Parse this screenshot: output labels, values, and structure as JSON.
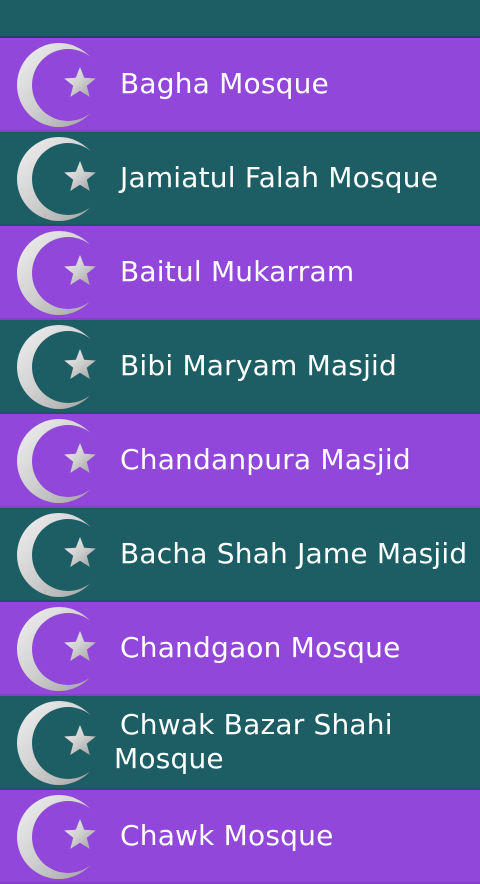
{
  "colors": {
    "purple": "#9147d9",
    "teal": "#1d5e65",
    "text": "#ffffff",
    "icon": "#d8d8d8"
  },
  "icon_name": "crescent-star-icon",
  "mosques": [
    {
      "name": "Bagha Mosque",
      "color": "purple"
    },
    {
      "name": "Jamiatul Falah Mosque",
      "color": "teal"
    },
    {
      "name": "Baitul Mukarram",
      "color": "purple"
    },
    {
      "name": "Bibi Maryam Masjid",
      "color": "teal"
    },
    {
      "name": "Chandanpura Masjid",
      "color": "purple"
    },
    {
      "name": "Bacha Shah Jame Masjid",
      "color": "teal"
    },
    {
      "name": "Chandgaon Mosque",
      "color": "purple"
    },
    {
      "name": "Chwak Bazar Shahi Mosque",
      "color": "teal"
    },
    {
      "name": "Chawk Mosque",
      "color": "purple"
    }
  ]
}
